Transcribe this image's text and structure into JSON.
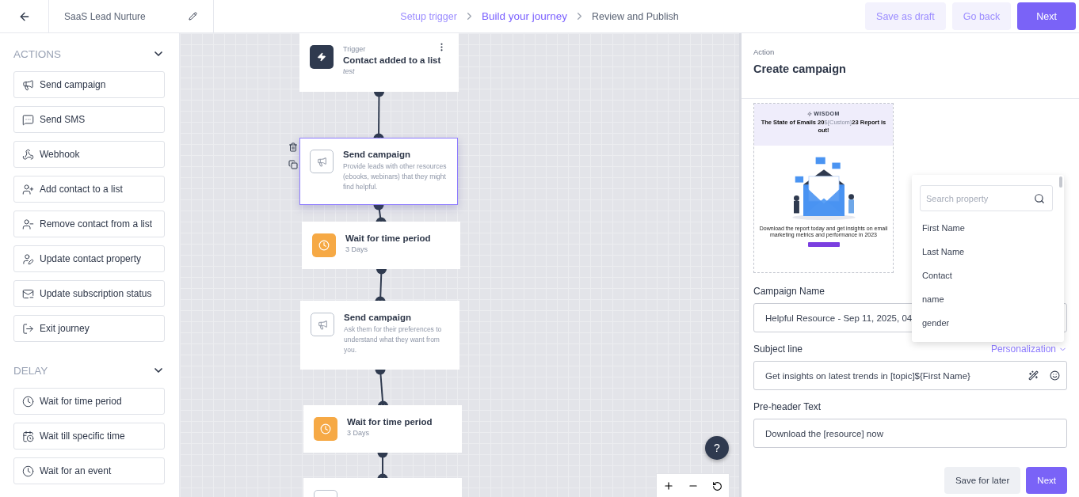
{
  "header": {
    "title": "SaaS Lead Nurture",
    "steps": [
      {
        "label": "Setup trigger",
        "selected": false,
        "completed": true
      },
      {
        "label": "Build your journey",
        "selected": true,
        "completed": false
      },
      {
        "label": "Review and Publish",
        "selected": false,
        "completed": false
      }
    ],
    "buttons": [
      {
        "label": "Save as draft",
        "kind": "secondary"
      },
      {
        "label": "Go back",
        "kind": "secondary"
      },
      {
        "label": "Next",
        "kind": "primary"
      }
    ]
  },
  "sidebar": {
    "sections": [
      {
        "title": "ACTIONS",
        "expanded": true,
        "items": [
          {
            "label": "Send campaign",
            "kind": "megaphone"
          },
          {
            "label": "Send SMS",
            "kind": "sms"
          },
          {
            "label": "Webhook",
            "kind": "webhook"
          },
          {
            "label": "Add contact to a list",
            "kind": "user-plus"
          },
          {
            "label": "Remove contact from a list",
            "kind": "user-minus"
          },
          {
            "label": "Update contact property",
            "kind": "user-up"
          },
          {
            "label": "Update subscription status",
            "kind": "mail"
          },
          {
            "label": "Exit journey",
            "kind": "exit"
          }
        ]
      },
      {
        "title": "DELAY",
        "expanded": true,
        "items": [
          {
            "label": "Wait for time period",
            "kind": "clock"
          },
          {
            "label": "Wait till specific time",
            "kind": "clock-calendar"
          },
          {
            "label": "Wait for an event",
            "kind": "clock"
          }
        ]
      }
    ]
  },
  "canvas": {
    "nodes": [
      {
        "kind": "trigger",
        "eyebrow": "Trigger",
        "title": "Contact added to a list",
        "subtitle": "test",
        "selected": false
      },
      {
        "kind": "campaign",
        "title": "Send campaign",
        "description": "Provide leads with other resources (ebooks, webinars) that they might find helpful.",
        "selected": true
      },
      {
        "kind": "wait",
        "title": "Wait for time period",
        "subtitle": "3 Days",
        "selected": false
      },
      {
        "kind": "campaign",
        "title": "Send campaign",
        "description": "Ask them for their preferences to understand what they want from you.",
        "selected": false
      },
      {
        "kind": "wait",
        "title": "Wait for time period",
        "subtitle": "3 Days",
        "selected": false
      },
      {
        "kind": "campaign",
        "selected": false
      }
    ],
    "help": "?"
  },
  "panel": {
    "eyebrow": "Action",
    "title": "Create campaign",
    "preview": {
      "brand": "WISDOM",
      "headline": [
        "The State of Emails 20",
        "${Custom}",
        "23 Report is out!"
      ],
      "body": "Download the report today and get insights on email marketing metrics and performance in 2023"
    },
    "fields": [
      {
        "label": "Campaign Name",
        "value": "Helpful Resource - Sep 11, 2025, 04",
        "kind": "plain"
      },
      {
        "label": "Subject line",
        "link": "Personalization",
        "value": "Get insights on latest trends in [topic]${First Name}",
        "kind": "tools"
      },
      {
        "label": "Pre-header Text",
        "value": "Download the [resource] now",
        "kind": "plain"
      }
    ],
    "dropdown": {
      "placeholder": "Search property",
      "options": [
        "First Name",
        "Last Name",
        "Contact",
        "name",
        "gender"
      ]
    },
    "buttons": [
      {
        "label": "Save for later",
        "kind": "secondary"
      },
      {
        "label": "Next",
        "kind": "primary"
      }
    ]
  }
}
